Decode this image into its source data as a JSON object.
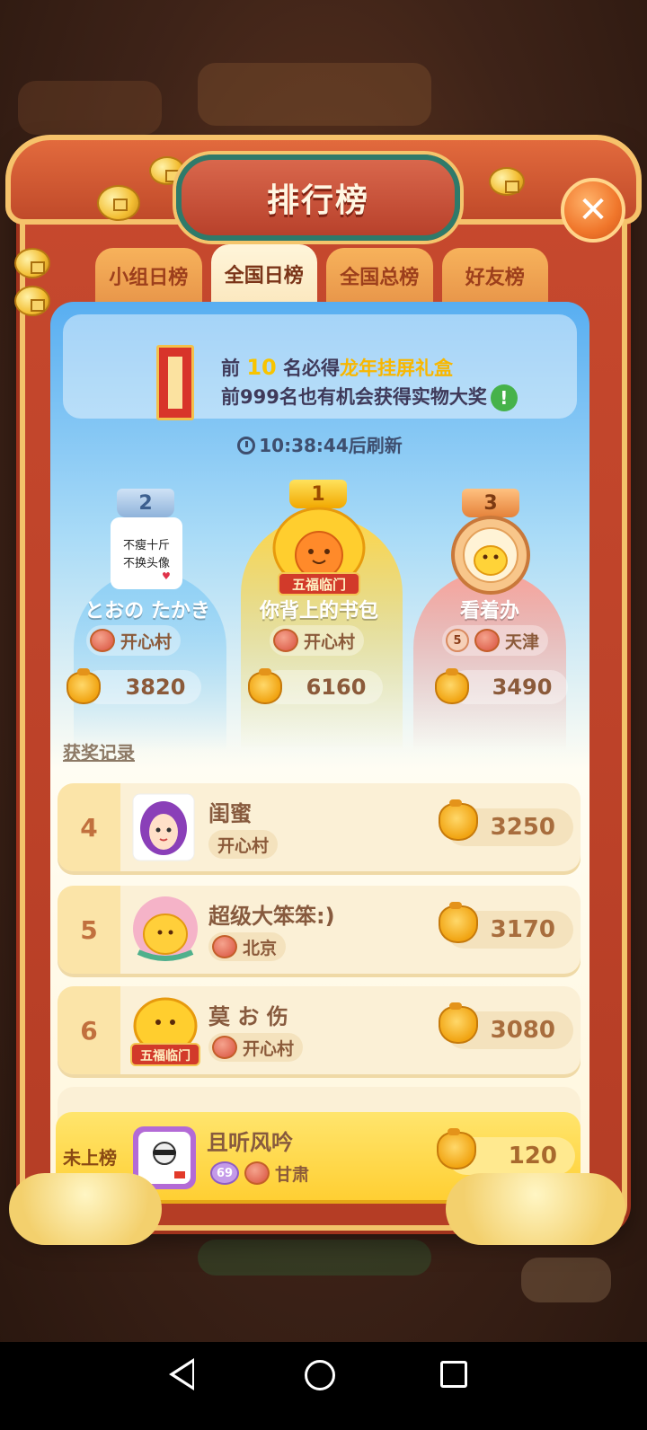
{
  "header": {
    "title": "排行榜"
  },
  "tabs": [
    {
      "label": "小组日榜",
      "active": false
    },
    {
      "label": "全国日榜",
      "active": true
    },
    {
      "label": "全国总榜",
      "active": false
    },
    {
      "label": "好友榜",
      "active": false
    }
  ],
  "banner": {
    "line1_prefix": "前 ",
    "line1_number": "10",
    "line1_mid": " 名必得",
    "line1_highlight": "龙年挂屏礼盒",
    "line2": "前999名也有机会获得实物大奖",
    "info_icon": "!"
  },
  "refresh": {
    "time": "10:38:44",
    "suffix": "后刷新"
  },
  "top3": [
    {
      "rank": "2",
      "name": "とおの たかき",
      "village": "开心村",
      "score": "3820",
      "avatar_text": "不瘦十斤不换头像"
    },
    {
      "rank": "1",
      "name": "你背上的书包",
      "village": "开心村",
      "score": "6160",
      "avatar_text": "五福临门"
    },
    {
      "rank": "3",
      "name": "看着办",
      "level": "5",
      "village": "天津",
      "score": "3490"
    }
  ],
  "award_link": "获奖记录",
  "rows": [
    {
      "rank": "4",
      "name": "闺蜜",
      "tag": "开心村",
      "score": "3250"
    },
    {
      "rank": "5",
      "name": "超级大笨笨:)",
      "tag": "北京",
      "score": "3170"
    },
    {
      "rank": "6",
      "name": "莫 お 伤",
      "tag": "开心村",
      "score": "3080",
      "avatar_text": "五福临门"
    }
  ],
  "me": {
    "rank": "未上榜",
    "name": "且听风吟",
    "level": "69",
    "tag": "甘肃",
    "score": "120"
  },
  "colors": {
    "gold": "#f8c400",
    "frame": "#b53d25",
    "sky": "#58aef1"
  }
}
